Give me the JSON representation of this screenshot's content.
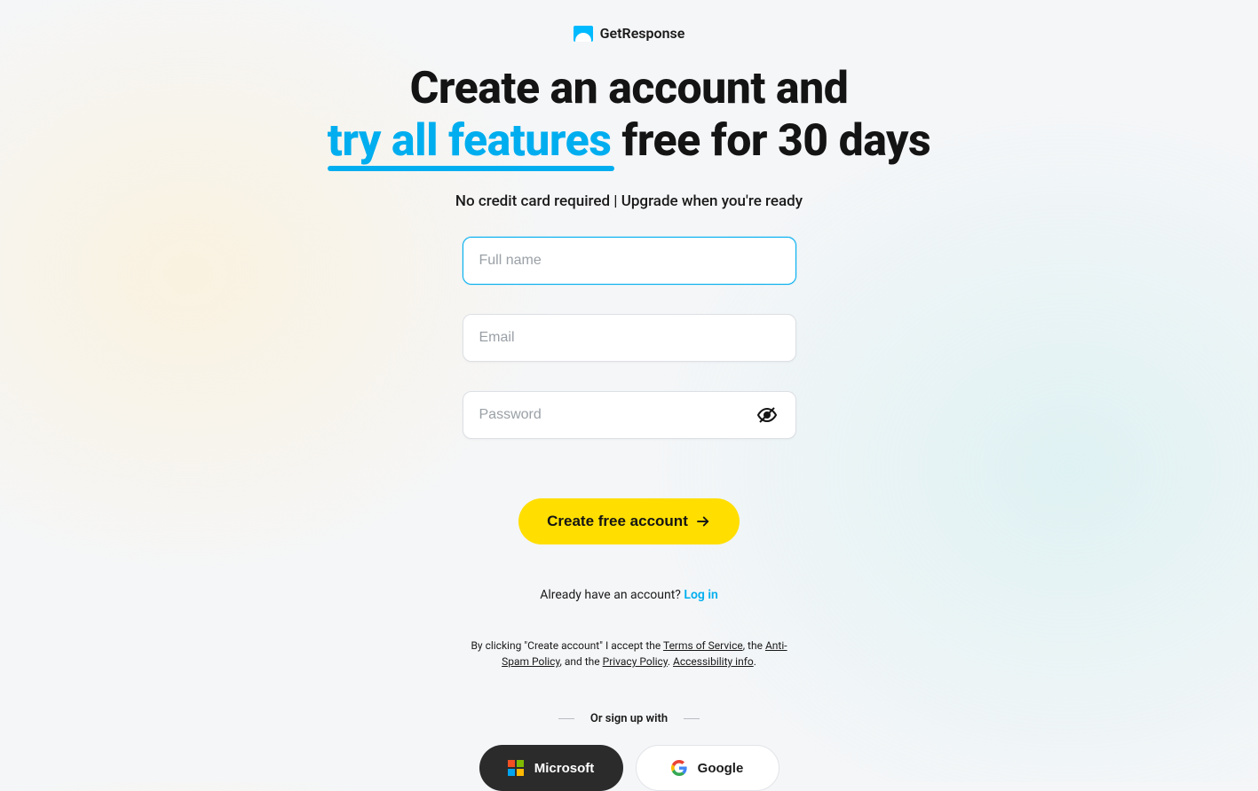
{
  "brand": {
    "name": "GetResponse"
  },
  "headline": {
    "line1": "Create an account and",
    "highlight": "try all features",
    "line2_rest": " free for 30 days"
  },
  "subhead": "No credit card required | Upgrade when you're ready",
  "form": {
    "fullname_placeholder": "Full name",
    "email_placeholder": "Email",
    "password_placeholder": "Password",
    "submit_label": "Create free account"
  },
  "login_prompt": {
    "text": "Already have an account? ",
    "link": "Log in"
  },
  "legal": {
    "prefix": "By clicking \"Create account\" I accept the ",
    "tos": "Terms of Service",
    "sep1": ", the ",
    "antispam": "Anti-Spam Policy",
    "sep2": ", and the ",
    "privacy": "Privacy Policy",
    "sep3": ". ",
    "accessibility": "Accessibility info",
    "suffix": "."
  },
  "divider_label": "Or sign up with",
  "social": {
    "microsoft": "Microsoft",
    "google": "Google"
  }
}
